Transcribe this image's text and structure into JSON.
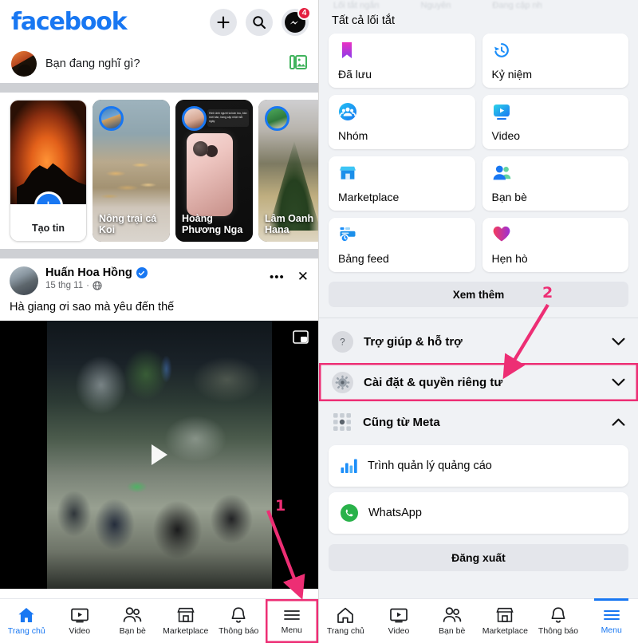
{
  "left": {
    "brand": "facebook",
    "topbar": {
      "add_label": "+",
      "search_label": "search-icon",
      "messenger_badge": "4"
    },
    "composer": {
      "placeholder": "Bạn đang nghĩ gì?",
      "photo_label": "photo-icon"
    },
    "stories": [
      {
        "name": "Tạo tin",
        "type": "create"
      },
      {
        "name": "Nông trại cá Koi",
        "type": "story"
      },
      {
        "name": "Hoàng Phương Nga",
        "type": "story"
      },
      {
        "name": "Lâm Oanh Hana",
        "type": "story"
      }
    ],
    "post": {
      "author": "Huấn Hoa Hồng",
      "date": "15 thg 11",
      "separator": "·",
      "text": "Hà giang ơi sao mà yêu đến thế",
      "more_label": "•••",
      "close_label": "✕"
    },
    "bottom_nav": [
      {
        "label": "Trang chủ",
        "icon": "home-icon",
        "active": true
      },
      {
        "label": "Video",
        "icon": "video-icon",
        "active": false
      },
      {
        "label": "Bạn bè",
        "icon": "friends-icon",
        "active": false
      },
      {
        "label": "Marketplace",
        "icon": "marketplace-icon",
        "active": false
      },
      {
        "label": "Thông báo",
        "icon": "bell-icon",
        "active": false
      },
      {
        "label": "Menu",
        "icon": "hamburger-icon",
        "active": false
      }
    ]
  },
  "right": {
    "ghost_tabs": [
      "Lối tắt ngắn",
      "Nguyên",
      "Đang cập nh"
    ],
    "section_title": "Tất cả lối tắt",
    "tiles": [
      {
        "label": "Đã lưu",
        "icon": "bookmark-icon"
      },
      {
        "label": "Kỷ niệm",
        "icon": "memories-clock-icon"
      },
      {
        "label": "Nhóm",
        "icon": "groups-icon"
      },
      {
        "label": "Video",
        "icon": "video-icon"
      },
      {
        "label": "Marketplace",
        "icon": "marketplace-icon"
      },
      {
        "label": "Bạn bè",
        "icon": "friends-icon"
      },
      {
        "label": "Bảng feed",
        "icon": "feeds-icon"
      },
      {
        "label": "Hẹn hò",
        "icon": "dating-heart-icon"
      }
    ],
    "more_button": "Xem thêm",
    "accordions": [
      {
        "label": "Trợ giúp & hỗ trợ",
        "icon": "question-icon",
        "expanded": false
      },
      {
        "label": "Cài đặt & quyền riêng tư",
        "icon": "gear-icon",
        "expanded": false
      }
    ],
    "meta_section": {
      "label": "Cũng từ Meta",
      "icon": "meta-grid-icon",
      "expanded": true,
      "apps": [
        {
          "label": "Trình quản lý quảng cáo",
          "icon": "ads-manager-icon"
        },
        {
          "label": "WhatsApp",
          "icon": "whatsapp-icon"
        }
      ]
    },
    "logout_button": "Đăng xuất",
    "bottom_nav": [
      {
        "label": "Trang chủ",
        "icon": "home-icon",
        "active": false
      },
      {
        "label": "Video",
        "icon": "video-icon",
        "active": false
      },
      {
        "label": "Bạn bè",
        "icon": "friends-icon",
        "active": false
      },
      {
        "label": "Marketplace",
        "icon": "marketplace-icon",
        "active": false
      },
      {
        "label": "Thông báo",
        "icon": "bell-icon",
        "active": false
      },
      {
        "label": "Menu",
        "icon": "hamburger-icon",
        "active": true
      }
    ]
  },
  "annotations": [
    {
      "number": "1",
      "color": "#ED2E74"
    },
    {
      "number": "2",
      "color": "#ED2E74"
    }
  ],
  "colors": {
    "brand_blue": "#1877F2",
    "annotation_pink": "#ED2E74",
    "panel_bg": "#F0F2F5",
    "badge_red": "#E41E3F"
  }
}
